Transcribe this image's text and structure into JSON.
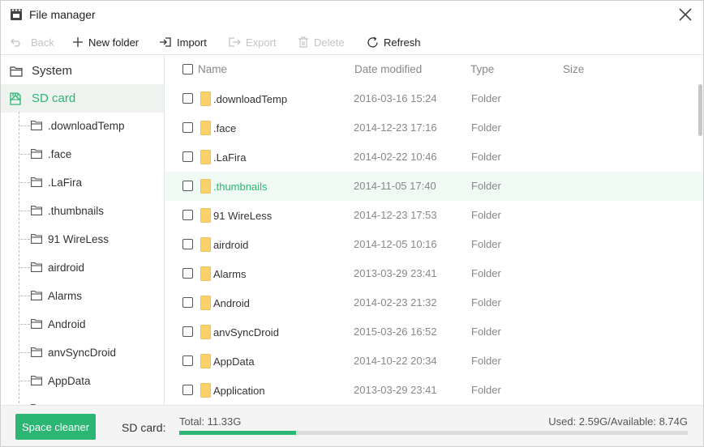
{
  "window": {
    "title": "File manager"
  },
  "toolbar": {
    "back": "Back",
    "new_folder": "New folder",
    "import": "Import",
    "export": "Export",
    "delete": "Delete",
    "refresh": "Refresh"
  },
  "sidebar": {
    "system": "System",
    "sd_card": "SD card",
    "items": [
      ".downloadTemp",
      ".face",
      ".LaFira",
      ".thumbnails",
      "91 WireLess",
      "airdroid",
      "Alarms",
      "Android",
      "anvSyncDroid",
      "AppData",
      "Application"
    ]
  },
  "list": {
    "columns": {
      "name": "Name",
      "date": "Date modified",
      "type": "Type",
      "size": "Size"
    },
    "rows": [
      {
        "name": ".downloadTemp",
        "date": "2016-03-16 15:24",
        "type": "Folder"
      },
      {
        "name": ".face",
        "date": "2014-12-23 17:16",
        "type": "Folder"
      },
      {
        "name": ".LaFira",
        "date": "2014-02-22 10:46",
        "type": "Folder"
      },
      {
        "name": ".thumbnails",
        "date": "2014-11-05 17:40",
        "type": "Folder"
      },
      {
        "name": "91 WireLess",
        "date": "2014-12-23 17:53",
        "type": "Folder"
      },
      {
        "name": "airdroid",
        "date": "2014-12-05 10:16",
        "type": "Folder"
      },
      {
        "name": "Alarms",
        "date": "2013-03-29 23:41",
        "type": "Folder"
      },
      {
        "name": "Android",
        "date": "2014-02-23 21:32",
        "type": "Folder"
      },
      {
        "name": "anvSyncDroid",
        "date": "2015-03-26 16:52",
        "type": "Folder"
      },
      {
        "name": "AppData",
        "date": "2014-10-22 20:34",
        "type": "Folder"
      },
      {
        "name": "Application",
        "date": "2013-03-29 23:41",
        "type": "Folder"
      }
    ]
  },
  "footer": {
    "space_cleaner": "Space cleaner",
    "sd_card_label": "SD card:",
    "total": "Total: 11.33G",
    "used_available": "Used: 2.59G/Available: 8.74G",
    "used_fraction": 0.229
  },
  "colors": {
    "accent": "#2bb673",
    "folder": "#f9d26b",
    "highlight_row": "#f0faf5"
  }
}
